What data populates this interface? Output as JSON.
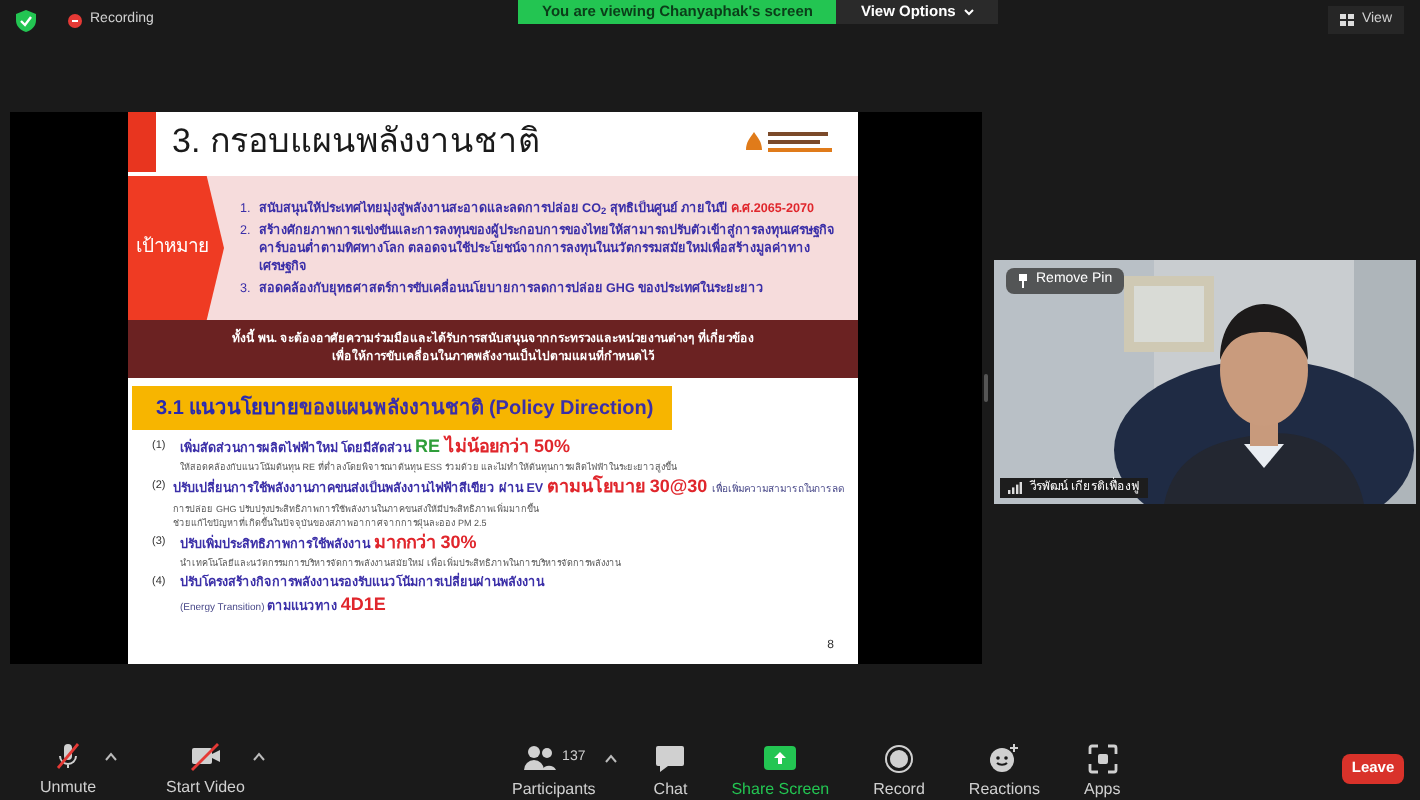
{
  "top_bar": {
    "recording": "Recording",
    "banner": "You are viewing Chanyaphak's screen",
    "view_options": "View Options",
    "view": "View"
  },
  "slide": {
    "title": "3. กรอบแผนพลังงานชาติ",
    "goal_label": "เป้าหมาย",
    "goals": [
      {
        "number": "1.",
        "segments": [
          {
            "kind": "plain",
            "text": "สนับสนุนให้ประเทศไทยมุ่งสู่พลังงานสะอาดและลดการปล่อย CO$_{2}$ สุทธิเป็นศูนย์ ภายในปี "
          },
          {
            "kind": "red",
            "text": "ค.ศ.2065-2070"
          }
        ]
      },
      {
        "number": "2.",
        "segments": [
          {
            "kind": "plain",
            "text": "สร้างศักยภาพการแข่งขันและการลงทุนของผู้ประกอบการของไทยให้สามารถปรับตัวเข้าสู่การลงทุนเศรษฐกิจคาร์บอนต่ำตามทิศทางโลก ตลอดจนใช้ประโยชน์จากการลงทุนในนวัตกรรมสมัยใหม่เพื่อสร้างมูลค่าทางเศรษฐกิจ"
          }
        ]
      },
      {
        "number": "3.",
        "segments": [
          {
            "kind": "plain",
            "text": "สอดคล้องกับยุทธศาสตร์การขับเคลื่อนนโยบายการลดการปล่อย GHG ของประเทศในระยะยาว"
          }
        ]
      }
    ],
    "note": [
      "ทั้งนี้ พน. จะต้องอาศัยความร่วมมือและได้รับการสนับสนุนจากกระทรวงและหน่วยงานต่างๆ ที่เกี่ยวข้อง",
      "เพื่อให้การขับเคลื่อนในภาคพลังงานเป็นไปตามแผนที่กำหนดไว้"
    ],
    "section_title": [
      {
        "kind": "strong",
        "text": "3.1 แนวนโยบาย"
      },
      {
        "kind": "plain",
        "text": "ของแผนพลังงานชาติ (Policy Direction)"
      }
    ],
    "policies": [
      {
        "number": "(1)",
        "segments": [
          {
            "kind": "plain",
            "text": "เพิ่มสัดส่วนการผลิตไฟฟ้าใหม่ โดยมีสัดส่วน "
          },
          {
            "kind": "green",
            "text": "RE "
          },
          {
            "kind": "accent",
            "text": "ไม่น้อยกว่า 50%"
          }
        ],
        "details": [
          "ให้สอดคล้องกับแนวโน้มต้นทุน RE ที่ต่ำลงโดยพิจารณาต้นทุน ESS ร่วมด้วย และไม่ทำให้ต้นทุนการผลิตไฟฟ้าในระยะยาวสูงขึ้น"
        ]
      },
      {
        "number": "(2)",
        "segments": [
          {
            "kind": "plain",
            "text": "ปรับเปลี่ยนการใช้พลังงานภาคขนส่งเป็นพลังงานไฟฟ้าสีเขียว ผ่าน EV "
          },
          {
            "kind": "accent",
            "text": "ตามนโยบาย 30@30 "
          },
          {
            "kind": "small",
            "text": "เพื่อเพิ่มความสามารถในการลด"
          }
        ],
        "details": [
          "การปล่อย GHG ปรับปรุงประสิทธิภาพการใช้พลังงานในภาคขนส่งให้มีประสิทธิภาพเพิ่มมากขึ้น",
          "ช่วยแก้ไขปัญหาที่เกิดขึ้นในปัจจุบันของสภาพอากาศจากการฝุ่นละออง PM 2.5"
        ]
      },
      {
        "number": "(3)",
        "segments": [
          {
            "kind": "plain",
            "text": "ปรับเพิ่มประสิทธิภาพการใช้พลังงาน "
          },
          {
            "kind": "accent",
            "text": "มากกว่า 30%"
          }
        ],
        "details": [
          "นำเทคโนโลยีและนวัตกรรมการบริหารจัดการพลังงานสมัยใหม่ เพื่อเพิ่มประสิทธิภาพในการบริหารจัดการพลังงาน"
        ]
      },
      {
        "number": "(4)",
        "segments": [
          {
            "kind": "plain",
            "text": "ปรับโครงสร้างกิจการพลังงานรองรับแนวโน้มการเปลี่ยนผ่านพลังงาน"
          }
        ],
        "continuation": [
          {
            "kind": "small",
            "text": "(Energy Transition) "
          },
          {
            "kind": "plain",
            "text": "ตามแนวทาง "
          },
          {
            "kind": "accent",
            "text": "4D1E"
          }
        ]
      }
    ],
    "page_number": "8"
  },
  "video": {
    "remove_pin": "Remove Pin",
    "name": "วีรพัฒน์ เกียรติเฟื่องฟู"
  },
  "toolbar": {
    "left": [
      {
        "label": "Unmute",
        "kind": "mic-off",
        "caret": true
      },
      {
        "label": "Start Video",
        "kind": "video-off",
        "caret": true
      }
    ],
    "center": [
      {
        "label": "Participants",
        "kind": "participants",
        "count": "137",
        "caret": true
      },
      {
        "label": "Chat",
        "kind": "chat",
        "caret": false
      },
      {
        "label": "Share Screen",
        "kind": "share",
        "caret": false
      },
      {
        "label": "Record",
        "kind": "record",
        "caret": false
      },
      {
        "label": "Reactions",
        "kind": "reactions",
        "caret": false
      },
      {
        "label": "Apps",
        "kind": "apps",
        "caret": false
      }
    ],
    "leave": "Leave"
  }
}
